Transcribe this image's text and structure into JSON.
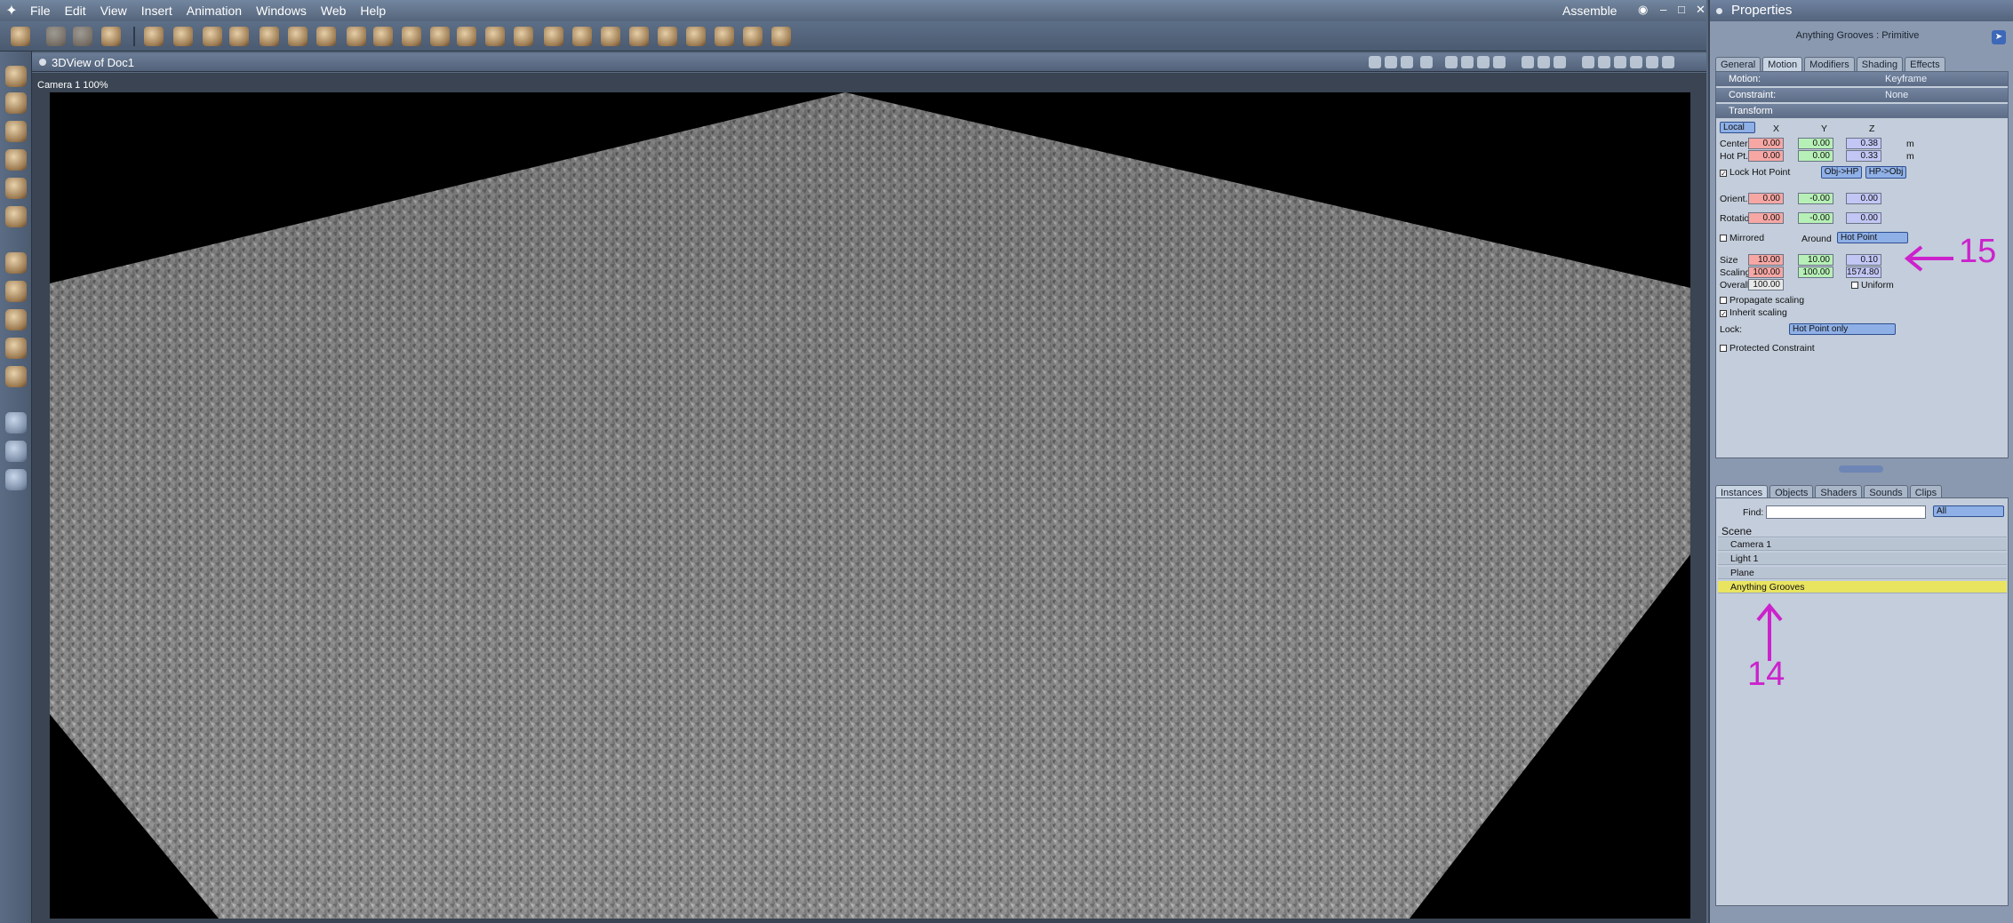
{
  "menubar": {
    "items": [
      "File",
      "Edit",
      "View",
      "Insert",
      "Animation",
      "Windows",
      "Web",
      "Help"
    ],
    "mode": "Assemble"
  },
  "viewport": {
    "title": "3DView of Doc1",
    "camera_label": "Camera 1 100%"
  },
  "properties": {
    "header": "Properties",
    "object_title": "Anything Grooves : Primitive",
    "tabs": [
      "General",
      "Motion",
      "Modifiers",
      "Shading",
      "Effects"
    ],
    "motion": {
      "label": "Motion:",
      "value": "Keyframe"
    },
    "constraint": {
      "label": "Constraint:",
      "value": "None"
    },
    "transform": {
      "label": "Transform",
      "space": "Local",
      "cols": [
        "X",
        "Y",
        "Z"
      ],
      "center": {
        "label": "Center",
        "x": "0.00",
        "y": "0.00",
        "z": "0.38",
        "unit": "m"
      },
      "hotpt": {
        "label": "Hot Pt.",
        "x": "0.00",
        "y": "0.00",
        "z": "0.33",
        "unit": "m"
      },
      "lock_hot_point": "Lock Hot Point",
      "obj_hp": "Obj->HP",
      "hp_obj": "HP->Obj",
      "orient": {
        "label": "Orient.",
        "x": "0.00",
        "y": "-0.00",
        "z": "0.00"
      },
      "rotation": {
        "label": "Rotation",
        "x": "0.00",
        "y": "-0.00",
        "z": "0.00"
      },
      "mirrored": "Mirrored",
      "around": "Around",
      "around_value": "Hot Point",
      "size": {
        "label": "Size",
        "x": "10.00",
        "y": "10.00",
        "z": "0.10"
      },
      "scaling": {
        "label": "Scaling",
        "x": "100.00",
        "y": "100.00",
        "z": "1574.80"
      },
      "overall": {
        "label": "Overall",
        "value": "100.00"
      },
      "uniform": "Uniform",
      "propagate": "Propagate scaling",
      "inherit": "Inherit scaling",
      "lock_label": "Lock:",
      "lock_value": "Hot Point only",
      "protected": "Protected Constraint"
    }
  },
  "browser": {
    "tabs": [
      "Instances",
      "Objects",
      "Shaders",
      "Sounds",
      "Clips"
    ],
    "find_label": "Find:",
    "filter": "All",
    "scene_label": "Scene",
    "items": [
      "Camera 1",
      "Light 1",
      "Plane",
      "Anything Grooves"
    ]
  },
  "annotations": {
    "a15": "15",
    "a14": "14"
  }
}
